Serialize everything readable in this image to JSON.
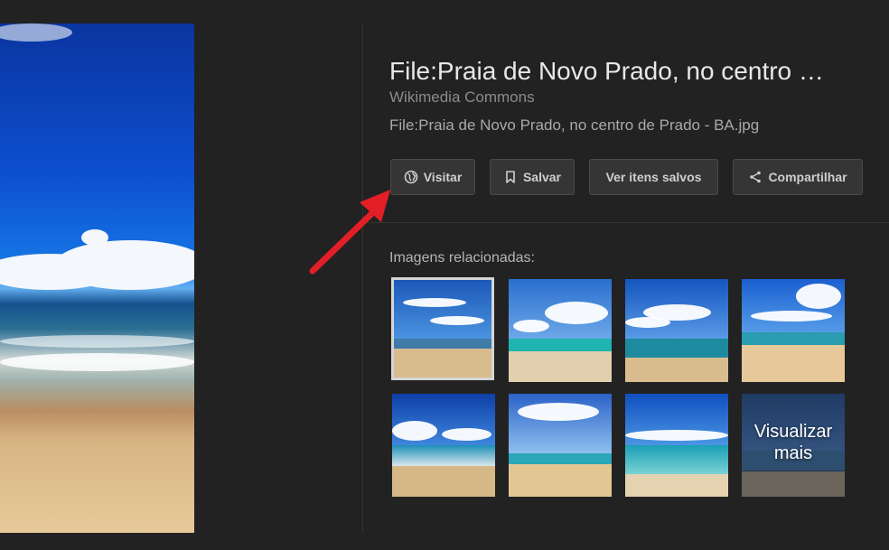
{
  "title": "File:Praia de Novo Prado, no centro …",
  "source": "Wikimedia Commons",
  "filename": "File:Praia de Novo Prado, no centro de Prado - BA.jpg",
  "buttons": {
    "visit": {
      "label": "Visitar",
      "icon": "globe-icon"
    },
    "save": {
      "label": "Salvar",
      "icon": "bookmark-icon"
    },
    "saved_items": {
      "label": "Ver itens salvos"
    },
    "share": {
      "label": "Compartilhar",
      "icon": "share-icon"
    }
  },
  "related": {
    "label": "Imagens relacionadas:",
    "more_label": "Visualizar mais"
  },
  "colors": {
    "background": "#222222",
    "button_bg": "#353535",
    "arrow": "#e21e26"
  }
}
